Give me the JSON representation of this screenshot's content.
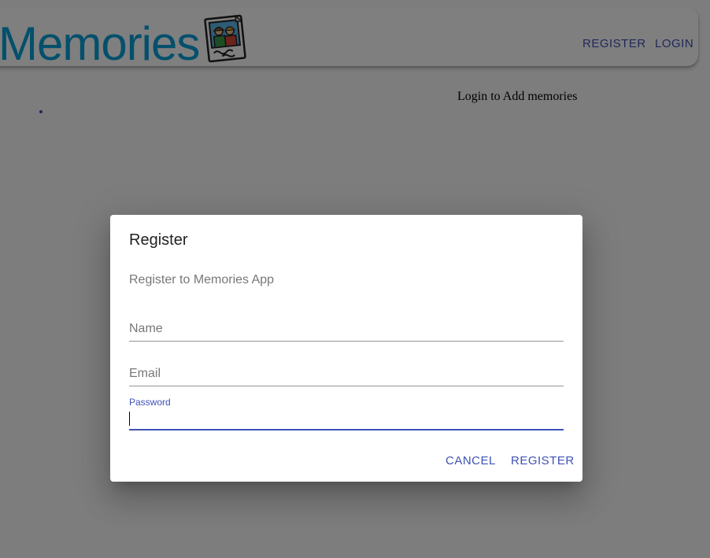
{
  "app": {
    "brand_name": "Memories",
    "brand_color": "#08a0d8",
    "logo_icon": "family-photo-icon"
  },
  "nav": {
    "register_label": "Register",
    "login_label": "Login",
    "accent_color": "#3f51b5"
  },
  "main": {
    "login_message": "Login to Add memories"
  },
  "dialog": {
    "title": "Register",
    "description": "Register to Memories App",
    "fields": {
      "name": {
        "label": "Name",
        "value": ""
      },
      "email": {
        "label": "Email",
        "value": ""
      },
      "password": {
        "label": "Password",
        "value": "",
        "focused": true
      }
    },
    "cancel_label": "Cancel",
    "register_label": "Register"
  }
}
